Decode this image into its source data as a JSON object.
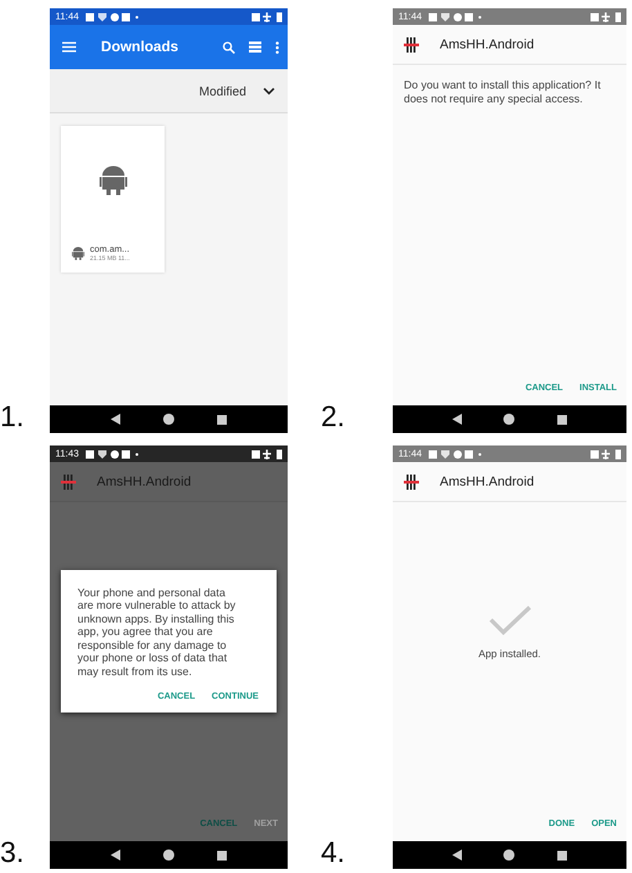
{
  "panels": [
    {
      "number": "1.",
      "kind": "files",
      "time": "11:44",
      "toolbar_title": "Downloads",
      "sort_label": "Modified",
      "files": [
        {
          "name": "com.am...",
          "details": "21.15 MB 11..."
        }
      ]
    },
    {
      "number": "2.",
      "kind": "install",
      "time": "11:44",
      "app_title": "AmsHH.Android",
      "message": "Do you want to install this application? It does not require any special access.",
      "buttons": [
        {
          "label": "CANCEL",
          "disabled": false
        },
        {
          "label": "INSTALL",
          "disabled": false
        }
      ]
    },
    {
      "number": "3.",
      "kind": "install",
      "dimmed": true,
      "time": "11:43",
      "app_title": "AmsHH.Android",
      "dialog": {
        "message": "Your phone and personal data are more vulnerable to attack by unknown apps. By installing this app, you agree that you are responsible for any damage to your phone or loss of data that may result from its use.",
        "buttons": [
          {
            "label": "CANCEL"
          },
          {
            "label": "CONTINUE"
          }
        ]
      },
      "buttons": [
        {
          "label": "CANCEL",
          "disabled": false
        },
        {
          "label": "NEXT",
          "disabled": true
        }
      ]
    },
    {
      "number": "4.",
      "kind": "installed",
      "time": "11:44",
      "app_title": "AmsHH.Android",
      "message": "App installed.",
      "buttons": [
        {
          "label": "DONE",
          "disabled": false
        },
        {
          "label": "OPEN",
          "disabled": false
        }
      ]
    }
  ]
}
